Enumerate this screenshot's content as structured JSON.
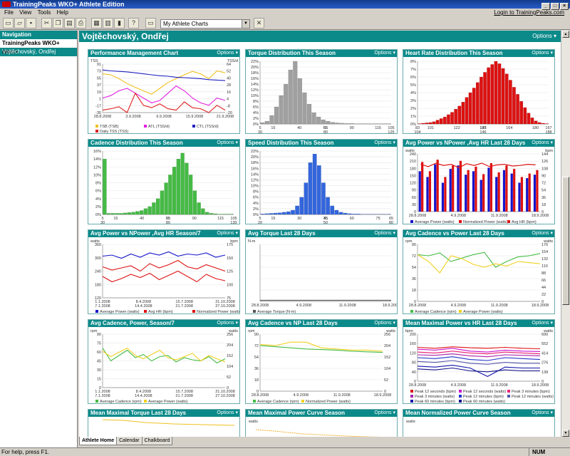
{
  "window": {
    "title": "TrainingPeaks WKO+ Athlete Edition"
  },
  "menu": {
    "items": [
      "File",
      "View",
      "Tools",
      "Help"
    ],
    "login": "Login to TrainingPeaks.com"
  },
  "toolbar": {
    "chart_select": "My Athlete Charts"
  },
  "nav": {
    "header": "Navigation",
    "items": [
      "TrainingPeaks WKO+ Home",
      "Vojtěchovský, Ondřej"
    ]
  },
  "main": {
    "title": "Vojtěchovský, Ondřej",
    "options": "Options ▾"
  },
  "tabs": [
    "Athlete Home",
    "Calendar",
    "Chalkboard"
  ],
  "status": {
    "text": "For help, press F1.",
    "num": "NUM"
  },
  "colors": {
    "teal": "#0c8a8a"
  },
  "chart_data": [
    {
      "type": "line",
      "title": "Performance Management Chart",
      "ylabel": "TSS",
      "ylabel2": "TSS/d",
      "yticks": [
        "91",
        "73",
        "55",
        "37",
        "19",
        "1",
        "-17",
        "-35"
      ],
      "y2ticks": [
        "64",
        "52",
        "40",
        "28",
        "16",
        "4",
        "-8",
        "-20"
      ],
      "xticks": [
        "28.8.2008",
        "3.9.2008",
        "9.9.2008",
        "15.9.2008",
        "21.9.2008"
      ],
      "series": [
        {
          "name": "TSB (TSB)",
          "color": "#f0c020",
          "values": [
            80,
            78,
            70,
            60,
            52,
            45,
            38,
            50,
            62,
            70,
            78,
            85,
            80,
            70,
            86,
            82
          ]
        },
        {
          "name": "ATL (TSS/d)",
          "color": "#e020e0",
          "values": [
            30,
            35,
            45,
            50,
            40,
            30,
            20,
            25,
            40,
            55,
            45,
            30,
            20,
            15,
            30,
            25
          ]
        },
        {
          "name": "CTL (TSS/d)",
          "color": "#2020c0",
          "values": [
            88,
            86,
            85,
            84,
            82,
            80,
            78,
            76,
            75,
            73,
            72,
            71,
            70,
            68,
            67,
            66
          ]
        },
        {
          "name": "Daily TSS (TSS)",
          "color": "#e02020",
          "values": [
            5,
            8,
            12,
            0,
            40,
            15,
            10,
            18,
            8,
            5,
            22,
            10,
            8,
            0,
            15,
            5
          ]
        }
      ]
    },
    {
      "type": "bar",
      "title": "Torque Distribution This Season",
      "color": "#a0a0a0",
      "yticks": [
        "22%",
        "20%",
        "18%",
        "16%",
        "14%",
        "12%",
        "10%",
        "8%",
        "6%",
        "4%",
        "2%",
        "0%"
      ],
      "ymax": 22,
      "xticks": [
        "5",
        "30",
        "55",
        "80",
        "105",
        "125"
      ],
      "subticks": [
        "15",
        "40",
        "65",
        "90",
        "115"
      ],
      "values": [
        0.5,
        1,
        3,
        6,
        10,
        14,
        19,
        22,
        16,
        11,
        7,
        4,
        2.5,
        1.5,
        1,
        0.6,
        0.4,
        0.3,
        0.2,
        0.2,
        0.1,
        0.1,
        0.1,
        0.1,
        0.1,
        0.1,
        0.1,
        0.1
      ]
    },
    {
      "type": "bar",
      "title": "Heart Rate Distribution This Season",
      "color": "#dd1111",
      "yticks": [
        "8%",
        "7%",
        "6%",
        "5%",
        "4%",
        "3%",
        "2%",
        "1%",
        "0%"
      ],
      "ymax": 8,
      "xticks": [
        "83",
        "104",
        "125",
        "146",
        "167",
        "188"
      ],
      "subticks": [
        "101",
        "122",
        "143",
        "164",
        "180"
      ],
      "values": [
        0.05,
        0.1,
        0.15,
        0.2,
        0.3,
        0.5,
        0.7,
        0.9,
        1.2,
        1.5,
        1.9,
        2.3,
        2.8,
        3.4,
        4,
        4.6,
        5.3,
        6,
        6.6,
        7.2,
        7.6,
        8,
        7.7,
        7.1,
        6.4,
        5.6,
        4.7,
        3.8,
        2.9,
        2.1,
        1.4,
        0.8,
        0.4,
        0.2,
        0.1,
        0.05
      ]
    },
    {
      "type": "bar",
      "title": "Cadence Distribution This Season",
      "color": "#44bb44",
      "yticks": [
        "16%",
        "14%",
        "12%",
        "10%",
        "8%",
        "6%",
        "4%",
        "2%",
        "0%"
      ],
      "ymax": 16,
      "xticks": [
        "5",
        "30",
        "55",
        "80",
        "105",
        "130"
      ],
      "subticks": [
        "15",
        "40",
        "65",
        "90",
        "115"
      ],
      "values": [
        14,
        0.3,
        0.3,
        0.3,
        0.3,
        0.4,
        0.5,
        0.6,
        0.8,
        1,
        1.5,
        2,
        3,
        4,
        6,
        8,
        10,
        12,
        14,
        15.5,
        13,
        10,
        6,
        3,
        1.5,
        0.6,
        0.3,
        0.2,
        0.1,
        0.1,
        0.1,
        0.1
      ]
    },
    {
      "type": "bar",
      "title": "Speed Distribution This Season",
      "color": "#3366dd",
      "yticks": [
        "22%",
        "20%",
        "18%",
        "16%",
        "14%",
        "12%",
        "10%",
        "8%",
        "6%",
        "4%",
        "2%",
        "0%"
      ],
      "ymax": 22,
      "xticks": [
        "5",
        "20",
        "35",
        "50",
        "65",
        "80"
      ],
      "subticks": [
        "15",
        "30",
        "45",
        "60",
        "75"
      ],
      "values": [
        0.2,
        0.3,
        0.4,
        0.5,
        0.6,
        0.8,
        1,
        1.5,
        3,
        6,
        11,
        18,
        21,
        17,
        11,
        6,
        3,
        1.5,
        0.8,
        0.5,
        0.3,
        0.2,
        0.2,
        0.1,
        0.1,
        0.1,
        0.1,
        0.1,
        0.1,
        0.1
      ]
    },
    {
      "type": "bar",
      "title": "Avg Power vs NPower ,Avg HR Last 28 Days",
      "ylabel": "watts",
      "ylabel2": "bpm",
      "yticks": [
        "240",
        "210",
        "180",
        "150",
        "120",
        "90",
        "60",
        "30",
        "0"
      ],
      "y2ticks": [
        "144",
        "126",
        "108",
        "90",
        "72",
        "54",
        "36",
        "18",
        "0"
      ],
      "xticks": [
        "28.8.2008",
        "4.9.2008",
        "11.9.2008",
        "18.9.2008"
      ],
      "series": [
        {
          "name": "Average Power (watts)",
          "color": "#1515cc"
        },
        {
          "name": "Normalized Power (watts)",
          "color": "#dd1111"
        },
        {
          "name": "Avg HR (bpm)",
          "color": "#dd1111"
        }
      ]
    },
    {
      "type": "line",
      "title": "Avg Power vs NPower ,Avg HR Season/7",
      "ylabel": "watts",
      "ylabel2": "bpm",
      "yticks": [
        "360",
        "300",
        "240",
        "180",
        "120"
      ],
      "y2ticks": [
        "175",
        "150",
        "125",
        "100",
        "75"
      ],
      "xticks": [
        "1.1.2008",
        "7.1.2008",
        "8.4.2008",
        "14.4.2008",
        "15.7.2008",
        "21.7.2008",
        "21.10.2008",
        "27.10.2008"
      ],
      "series": [
        {
          "name": "Average Power (watts)",
          "color": "#1515cc"
        },
        {
          "name": "Avg HR (bpm)",
          "color": "#dd1111"
        },
        {
          "name": "Normalized Power (watts)",
          "color": "#dd1111"
        }
      ]
    },
    {
      "type": "line",
      "title": "Avg Torque Last 28 Days",
      "ylabel": "N-m",
      "xticks": [
        "28.8.2008",
        "4.9.2008",
        "11.9.2008",
        "18.9.2008"
      ],
      "series": [
        {
          "name": "Average Torque (N-m)",
          "color": "#555555"
        }
      ]
    },
    {
      "type": "line",
      "title": "Avg Cadence vs Power Last 28 Days",
      "ylabel": "rpm",
      "ylabel2": "watts",
      "yticks": [
        "90",
        "72",
        "54",
        "36",
        "18",
        "0"
      ],
      "y2ticks": [
        "176",
        "154",
        "132",
        "110",
        "88",
        "66",
        "44",
        "22",
        "0"
      ],
      "xticks": [
        "28.8.2008",
        "4.9.2008",
        "11.9.2008",
        "18.9.2008"
      ],
      "series": [
        {
          "name": "Average Cadence (rpm)",
          "color": "#44bb44"
        },
        {
          "name": "Average Power (watts)",
          "color": "#f0d020"
        }
      ]
    },
    {
      "type": "line",
      "title": "Avg Cadence, Power, Season/7",
      "ylabel": "rpm",
      "ylabel2": "watts",
      "yticks": [
        "90",
        "75",
        "60",
        "45",
        "30",
        "15",
        "0"
      ],
      "y2ticks": [
        "256",
        "204",
        "152",
        "104",
        "52",
        "0"
      ],
      "xticks": [
        "1.1.2008",
        "7.1.2008",
        "8.4.2008",
        "14.4.2008",
        "15.7.2008",
        "21.7.2008",
        "21.10.2008",
        "27.10.2008"
      ],
      "series": [
        {
          "name": "Average Cadence (rpm)",
          "color": "#44bb44"
        },
        {
          "name": "Average Power (watts)",
          "color": "#f0d020"
        }
      ]
    },
    {
      "type": "line",
      "title": "Avg Cadence vs NP Last 28 Days",
      "ylabel": "rpm",
      "ylabel2": "watts",
      "yticks": [
        "90",
        "72",
        "54",
        "36",
        "18",
        "0"
      ],
      "y2ticks": [
        "256",
        "204",
        "152",
        "104",
        "52",
        "0"
      ],
      "xticks": [
        "28.8.2008",
        "4.9.2008",
        "11.9.2008",
        "18.9.2008"
      ],
      "series": [
        {
          "name": "Average Cadence (rpm)",
          "color": "#44bb44"
        },
        {
          "name": "Normalized Power (watts)",
          "color": "#f0d020"
        }
      ]
    },
    {
      "type": "line",
      "title": "Mean Maximal Power vs HR Last 28 Days",
      "ylabel": "bpm",
      "ylabel2": "watts",
      "yticks": [
        "200",
        "160",
        "120",
        "80",
        "40",
        "0"
      ],
      "y2ticks": [
        "690",
        "552",
        "414",
        "276",
        "138",
        "0"
      ],
      "xticks": [
        "28.8.2008",
        "4.9.2008",
        "11.9.2008",
        "18.9.2008"
      ],
      "series": [
        {
          "name": "Peak 12 seconds (bpm)",
          "color": "#dd1111"
        },
        {
          "name": "Peak 12 seconds (watts)",
          "color": "#cc11cc"
        },
        {
          "name": "Peak 3 minutes (bpm)",
          "color": "#ee2277"
        },
        {
          "name": "Peak 3 minutes (watts)",
          "color": "#aa22aa"
        },
        {
          "name": "Peak 12 minutes (bpm)",
          "color": "#2233cc"
        },
        {
          "name": "Peak 12 minutes (watts)",
          "color": "#5555aa"
        },
        {
          "name": "Peak 60 minutes (bpm)",
          "color": "#1111aa"
        },
        {
          "name": "Peak 60 minutes (watts)",
          "color": "#111188"
        }
      ]
    },
    {
      "type": "line",
      "title": "Mean Maximal Torque Last 28 Days"
    },
    {
      "type": "line",
      "title": "Mean Maximal Power Curve Season",
      "ylabel": "watts"
    },
    {
      "type": "line",
      "title": "Mean Normalized Power Curve Season",
      "ylabel": "watts"
    }
  ]
}
